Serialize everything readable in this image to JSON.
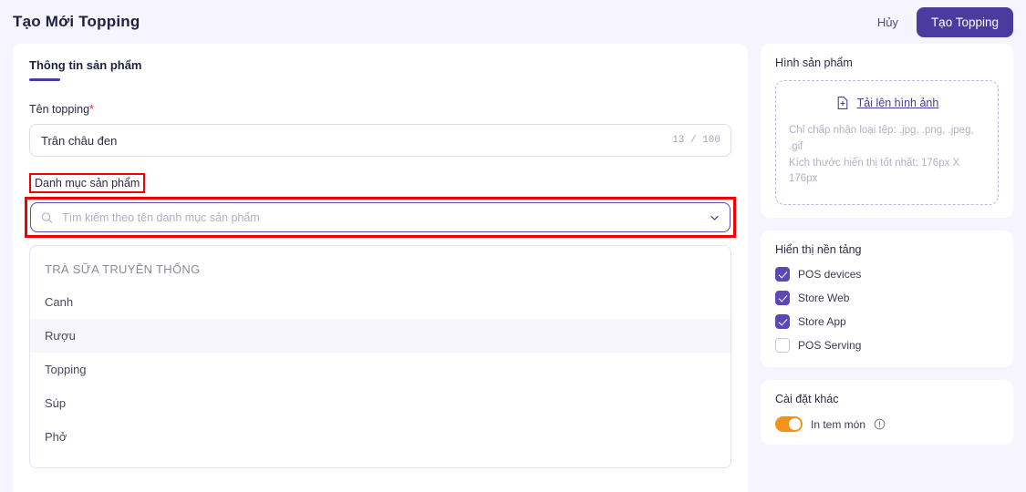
{
  "header": {
    "title": "Tạo Mới Topping",
    "cancel_label": "Hủy",
    "primary_label": "Tạo Topping"
  },
  "left_panel": {
    "tab_label": "Thông tin sản phẩm",
    "name_field": {
      "label": "Tên topping",
      "required_mark": "*",
      "value": "Trân châu đen",
      "counter": "13 / 100"
    },
    "category_field": {
      "label": "Danh mục sản phẩm",
      "placeholder": "Tìm kiếm theo tên danh mục sản phẩm",
      "value": "",
      "options": [
        {
          "label": "TRÀ SỮA TRUYỀN THỐNG",
          "type": "group"
        },
        {
          "label": "Canh",
          "type": "item",
          "highlighted": false
        },
        {
          "label": "Rượu",
          "type": "item",
          "highlighted": true
        },
        {
          "label": "Topping",
          "type": "item",
          "highlighted": false
        },
        {
          "label": "Súp",
          "type": "item",
          "highlighted": false
        },
        {
          "label": "Phở",
          "type": "item",
          "highlighted": false
        }
      ]
    }
  },
  "right_panel": {
    "image_card": {
      "title": "Hình sản phẩm",
      "upload_link": "Tải lên hình ảnh",
      "hint_line1": "Chỉ chấp nhận loại tệp: .jpg, .png, .jpeg, .gif",
      "hint_line2": "Kích thước hiển thị tốt nhất: 176px X 176px"
    },
    "platform_card": {
      "title": "Hiển thị nền tảng",
      "items": [
        {
          "label": "POS devices",
          "checked": true
        },
        {
          "label": "Store Web",
          "checked": true
        },
        {
          "label": "Store App",
          "checked": true
        },
        {
          "label": "POS Serving",
          "checked": false
        }
      ]
    },
    "other_card": {
      "title": "Cài đặt khác",
      "toggle_label": "In tem món",
      "toggle_on": true
    }
  },
  "colors": {
    "accent": "#4b3b9e",
    "page_bg": "#f6f4fe",
    "annotation": "#f20000",
    "toggle_on": "#f5921e"
  }
}
